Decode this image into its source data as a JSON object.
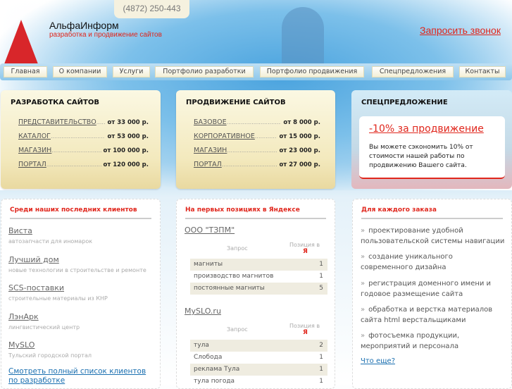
{
  "header": {
    "phone": "(4872) 250-443",
    "brand": "АльфаИнформ",
    "tagline": "разработка и продвижение сайтов",
    "call_link": "Запросить звонок"
  },
  "nav": [
    "Главная",
    "О компании",
    "Услуги",
    "Портфолио разработки",
    "Портфолио продвижения",
    "Спецпредложения",
    "Контакты"
  ],
  "dev": {
    "title": "РАЗРАБОТКА САЙТОВ",
    "items": [
      {
        "name": "ПРЕДСТАВИТЕЛЬСТВО",
        "price": "от 33 000 р."
      },
      {
        "name": "КАТАЛОГ",
        "price": "от 53 000 р."
      },
      {
        "name": "МАГАЗИН",
        "price": "от 100 000 р."
      },
      {
        "name": "ПОРТАЛ",
        "price": "от 120 000 р."
      }
    ]
  },
  "promo": {
    "title": "ПРОДВИЖЕНИЕ САЙТОВ",
    "items": [
      {
        "name": "БАЗОВОЕ",
        "price": "от 8 000 р."
      },
      {
        "name": "КОРПОРАТИВНОЕ",
        "price": "от 15 000 р."
      },
      {
        "name": "МАГАЗИН",
        "price": "от 23 000 р."
      },
      {
        "name": "ПОРТАЛ",
        "price": "от 27 000 р."
      }
    ]
  },
  "special": {
    "title": "СПЕЦПРЕДЛОЖЕНИЕ",
    "offer": "-10% за продвижение",
    "text": "Вы можете сэкономить 10% от стоимости нашей работы по продвижению Вашего сайта."
  },
  "clients": {
    "title": "Среди наших последних клиентов",
    "items": [
      {
        "name": "Виста",
        "desc": "автозапчасти для иномарок"
      },
      {
        "name": "Лучший дом",
        "desc": "новые технологии в строительстве и ремонте"
      },
      {
        "name": "SCS-поставки",
        "desc": "строительные материалы из КНР"
      },
      {
        "name": "ЛэнАрк",
        "desc": "лингвистический центр"
      },
      {
        "name": "MySLO",
        "desc": "Тульский городской портал"
      }
    ],
    "all_link": "Смотреть полный список клиентов по разработке"
  },
  "yandex": {
    "title": "На первых позициях в Яндексе",
    "col_query": "Запрос",
    "col_pos": "Позиция в",
    "ya": "Я",
    "sites": [
      {
        "name": "ООО \"ТЗПМ\"",
        "rows": [
          {
            "q": "магниты",
            "p": "1"
          },
          {
            "q": "производство магнитов",
            "p": "1"
          },
          {
            "q": "постоянные магниты",
            "p": "5"
          }
        ]
      },
      {
        "name": "MySLO.ru",
        "rows": [
          {
            "q": "тула",
            "p": "2"
          },
          {
            "q": "Слобода",
            "p": "1"
          },
          {
            "q": "реклама Тула",
            "p": "1"
          },
          {
            "q": "тула погода",
            "p": "1"
          }
        ]
      }
    ]
  },
  "order": {
    "title": "Для каждого заказа",
    "arrow": "»",
    "items": [
      "проектирование удобной пользовательской системы навигации",
      "создание уникального современного дизайна",
      "регистрация доменного имени и годовое размещение сайта",
      "обработка и верстка материалов сайта html верстальщиками",
      "фотосъемка продукции, мероприятий и персонала"
    ],
    "more": "Что еще?"
  }
}
